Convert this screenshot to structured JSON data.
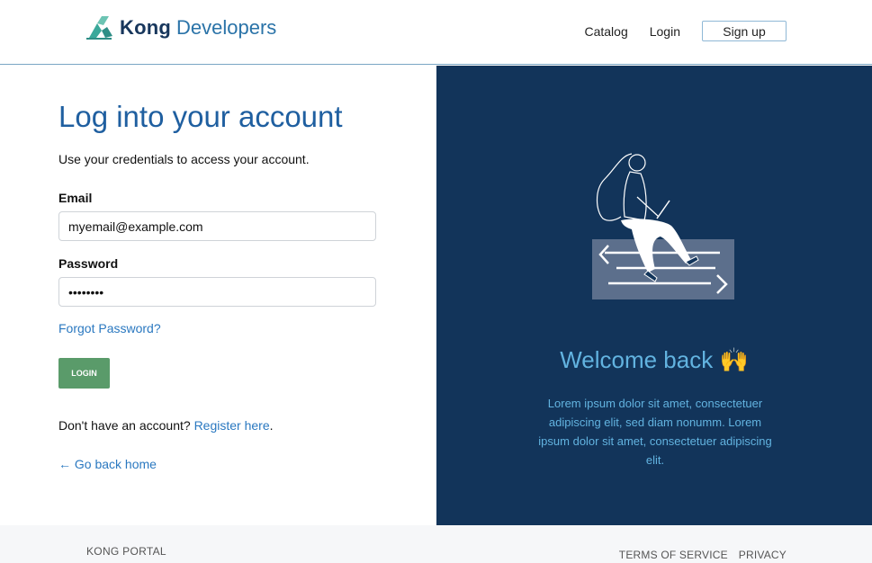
{
  "header": {
    "brand_bold": "Kong",
    "brand_light": "Developers",
    "nav": {
      "catalog": "Catalog",
      "login": "Login",
      "signup": "Sign up"
    }
  },
  "login": {
    "title": "Log into your account",
    "subtitle": "Use your credentials to access your account.",
    "email_label": "Email",
    "email_value": "myemail@example.com",
    "password_label": "Password",
    "password_value": "••••••••",
    "forgot": "Forgot Password?",
    "button": "LOGIN",
    "register_prefix": "Don't have an account?",
    "register_link": "Register here",
    "register_suffix": ".",
    "go_back": "← Go back home"
  },
  "promo": {
    "welcome": "Welcome back 🙌",
    "body": "Lorem ipsum dolor sit amet, consectetuer adipiscing elit, sed diam nonumm. Lorem ipsum dolor sit amet, consectetuer adipiscing elit."
  },
  "footer": {
    "brand": "KONG PORTAL",
    "terms": "TERMS OF SERVICE",
    "privacy": "PRIVACY"
  },
  "colors": {
    "accent": "#1f5fa0",
    "link": "#2a78c0",
    "login_button": "#5a9b6a",
    "panel": "#12345a",
    "panel_text": "#62b3e0"
  },
  "icons": [
    "kong-logo-icon",
    "arrow-left-icon",
    "illustration-person-laptop"
  ]
}
